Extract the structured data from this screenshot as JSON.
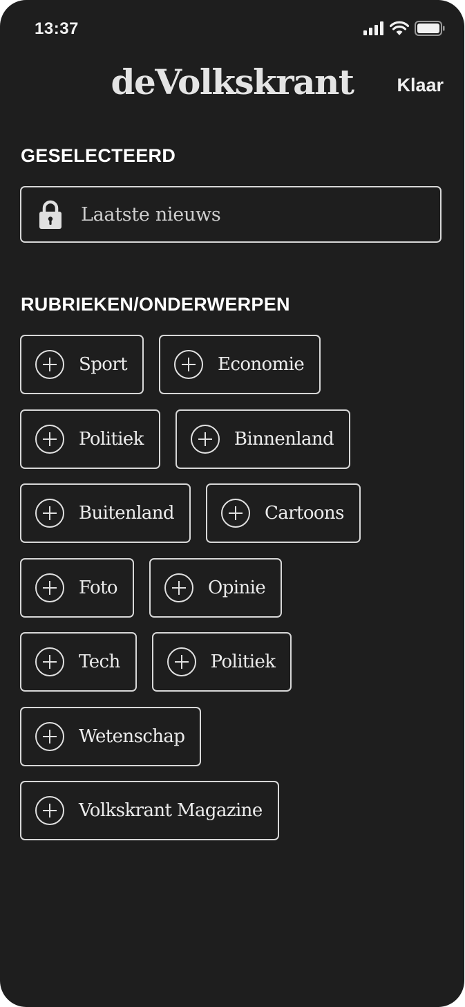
{
  "status_bar": {
    "time": "13:37"
  },
  "header": {
    "logo_text": "deVolkskrant",
    "done_label": "Klaar"
  },
  "selected": {
    "heading": "GESELECTEERD",
    "items": [
      {
        "label": "Laatste nieuws",
        "icon": "lock-icon"
      }
    ]
  },
  "topics": {
    "heading": "RUBRIEKEN/ONDERWERPEN",
    "rows": [
      [
        {
          "label": "Sport"
        },
        {
          "label": "Economie"
        }
      ],
      [
        {
          "label": "Politiek"
        },
        {
          "label": "Binnenland"
        }
      ],
      [
        {
          "label": "Buitenland"
        },
        {
          "label": "Cartoons"
        }
      ],
      [
        {
          "label": "Foto"
        },
        {
          "label": "Opinie"
        }
      ],
      [
        {
          "label": "Tech"
        },
        {
          "label": "Politiek"
        }
      ],
      [
        {
          "label": "Wetenschap"
        }
      ],
      [
        {
          "label": "Volkskrant Magazine"
        }
      ]
    ],
    "chip_icon": "plus-circle-icon"
  },
  "colors": {
    "background": "#1e1e1e",
    "border": "#d8d8d8",
    "text": "#ececec"
  }
}
